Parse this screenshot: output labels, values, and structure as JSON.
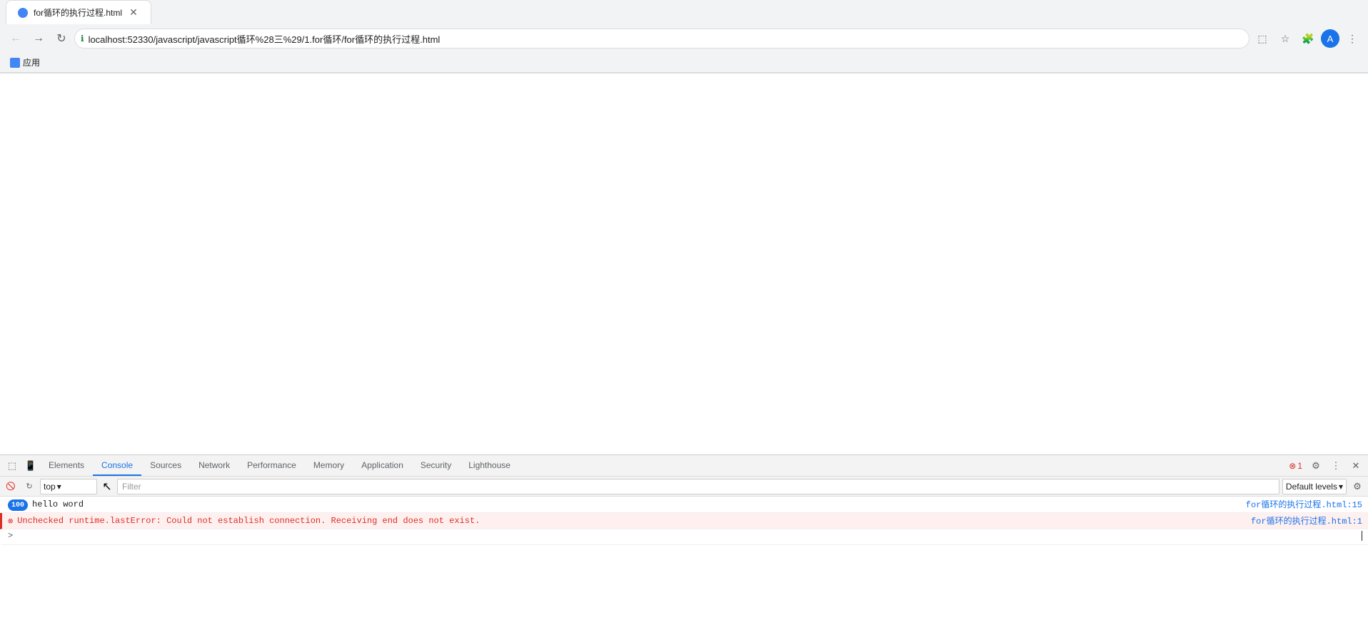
{
  "browser": {
    "back_btn": "←",
    "forward_btn": "→",
    "reload_btn": "↻",
    "url": "localhost:52330/javascript/javascript循环%28三%29/1.for循环/for循环的执行过程.html",
    "tab_title": "for循环的执行过程.html",
    "bookmarks_item": "应用"
  },
  "devtools": {
    "tabs": [
      {
        "id": "elements",
        "label": "Elements",
        "active": false
      },
      {
        "id": "console",
        "label": "Console",
        "active": true
      },
      {
        "id": "sources",
        "label": "Sources",
        "active": false
      },
      {
        "id": "network",
        "label": "Network",
        "active": false
      },
      {
        "id": "performance",
        "label": "Performance",
        "active": false
      },
      {
        "id": "memory",
        "label": "Memory",
        "active": false
      },
      {
        "id": "application",
        "label": "Application",
        "active": false
      },
      {
        "id": "security",
        "label": "Security",
        "active": false
      },
      {
        "id": "lighthouse",
        "label": "Lighthouse",
        "active": false
      }
    ],
    "error_count": "1",
    "console_toolbar": {
      "context": "top",
      "filter_placeholder": "Filter",
      "levels_label": "Default levels"
    },
    "console_rows": [
      {
        "type": "log",
        "badge": "100",
        "text": "hello word",
        "link": "for循环的执行过程.html:15",
        "link2": null
      },
      {
        "type": "error",
        "text": "Unchecked runtime.lastError: Could not establish connection. Receiving end does not exist.",
        "link": "for循环的执行过程.html:1",
        "link2": null
      },
      {
        "type": "input",
        "text": "",
        "prompt": ">"
      }
    ]
  }
}
